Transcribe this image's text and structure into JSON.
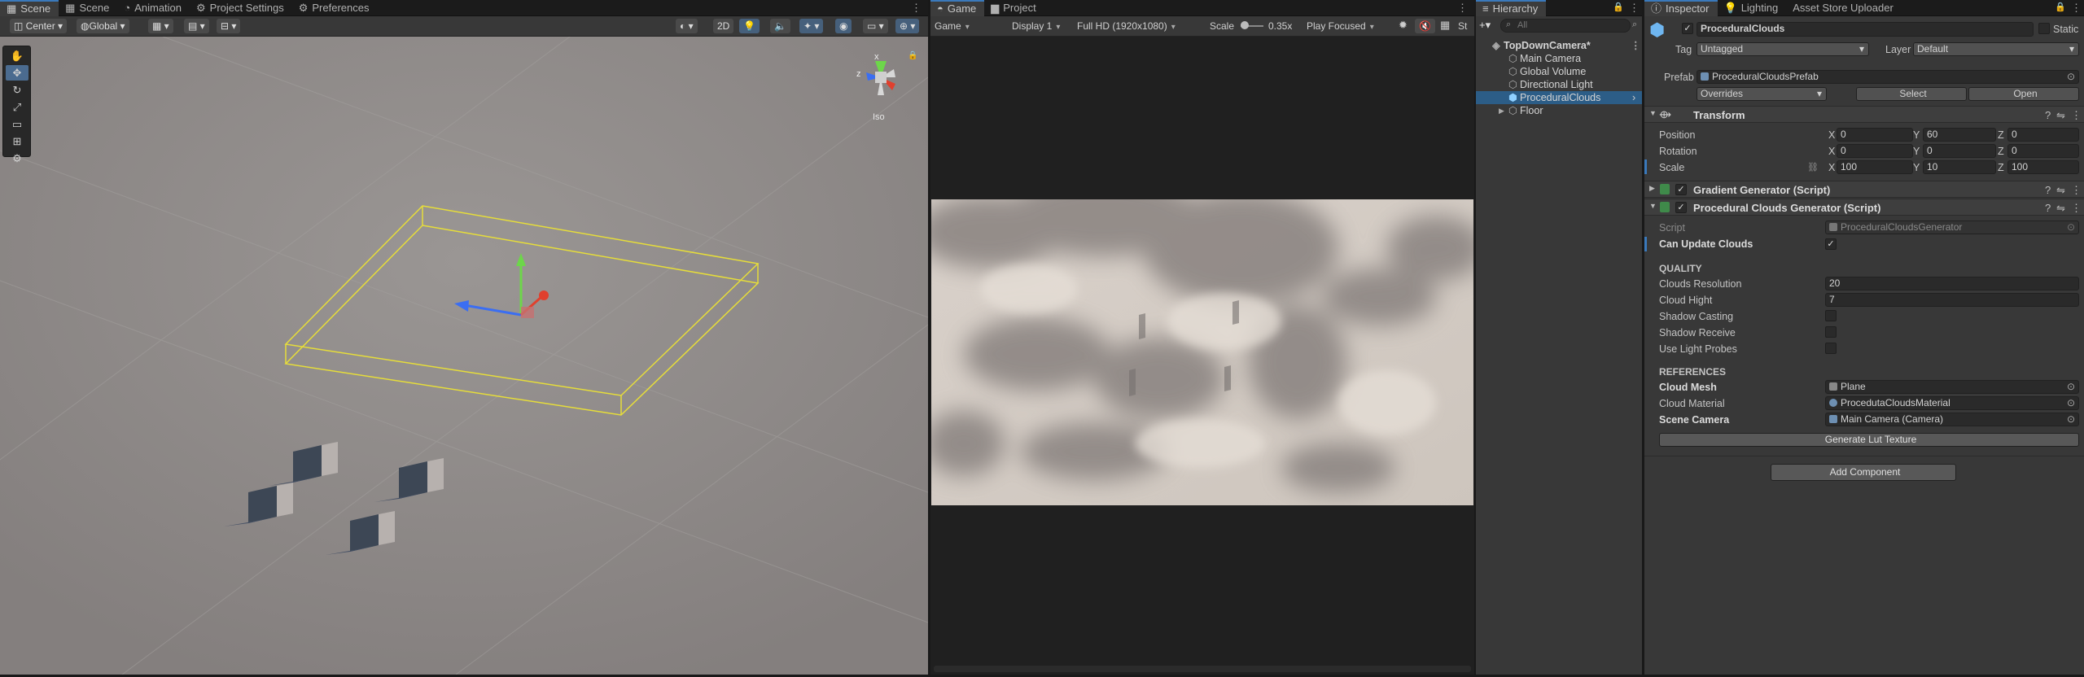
{
  "scene_tabs": [
    "Scene",
    "Scene",
    "Animation",
    "Project Settings",
    "Preferences"
  ],
  "scene_toolbar": {
    "pivot": "Center",
    "space": "Global",
    "mode_2d": "2D"
  },
  "scene_gizmo": {
    "axis_x": "x",
    "axis_z": "z",
    "projection": "Iso"
  },
  "game_tabs": [
    "Game",
    "Project"
  ],
  "game_toolbar": {
    "view": "Game",
    "display": "Display 1",
    "resolution": "Full HD (1920x1080)",
    "scale_label": "Scale",
    "scale_value": "0.35x",
    "play_mode": "Play Focused",
    "stats": "St"
  },
  "hierarchy": {
    "tab": "Hierarchy",
    "search_placeholder": "All",
    "root": "TopDownCamera*",
    "items": [
      "Main Camera",
      "Global Volume",
      "Directional Light",
      "ProceduralClouds",
      "Floor"
    ]
  },
  "inspector": {
    "tabs": [
      "Inspector",
      "Lighting",
      "Asset Store Uploader"
    ],
    "object_name": "ProceduralClouds",
    "static_label": "Static",
    "tag_label": "Tag",
    "tag_value": "Untagged",
    "layer_label": "Layer",
    "layer_value": "Default",
    "prefab_label": "Prefab",
    "prefab_value": "ProceduralCloudsPrefab",
    "overrides": "Overrides",
    "select": "Select",
    "open": "Open",
    "transform": {
      "title": "Transform",
      "position_label": "Position",
      "position": [
        "0",
        "60",
        "0"
      ],
      "rotation_label": "Rotation",
      "rotation": [
        "0",
        "0",
        "0"
      ],
      "scale_label": "Scale",
      "scale": [
        "100",
        "10",
        "100"
      ],
      "axes": [
        "X",
        "Y",
        "Z"
      ]
    },
    "gradient_title": "Gradient Generator (Script)",
    "clouds_title": "Procedural Clouds Generator (Script)",
    "script_label": "Script",
    "script_value": "ProceduralCloudsGenerator",
    "can_update_label": "Can Update Clouds",
    "quality_header": "QUALITY",
    "resolution_label": "Clouds Resolution",
    "resolution_value": "20",
    "height_label": "Cloud Hight",
    "height_value": "7",
    "shadow_casting_label": "Shadow Casting",
    "shadow_receive_label": "Shadow Receive",
    "light_probes_label": "Use Light Probes",
    "references_header": "REFERENCES",
    "mesh_label": "Cloud Mesh",
    "mesh_value": "Plane",
    "material_label": "Cloud Material",
    "material_value": "ProcedutaCloudsMaterial",
    "camera_label": "Scene Camera",
    "camera_value": "Main Camera (Camera)",
    "generate_button": "Generate Lut Texture",
    "add_component": "Add Component"
  },
  "colors": {
    "selection": "#2c5d87",
    "accent": "#3a79bb",
    "panel": "#383838",
    "scene_bg": "#8f8c8b"
  }
}
